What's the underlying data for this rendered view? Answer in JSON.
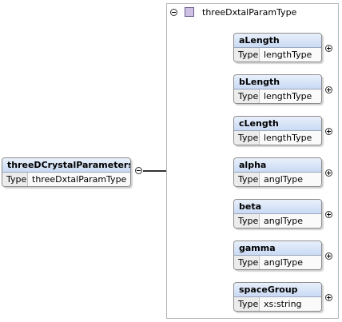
{
  "root": {
    "name": "threeDCrystalParameters",
    "type_key": "Type",
    "type_value": "threeDxtalParamType"
  },
  "complex_type": {
    "name": "threeDxtalParamType"
  },
  "children": [
    {
      "name": "aLength",
      "type_key": "Type",
      "type_value": "lengthType"
    },
    {
      "name": "bLength",
      "type_key": "Type",
      "type_value": "lengthType"
    },
    {
      "name": "cLength",
      "type_key": "Type",
      "type_value": "lengthType"
    },
    {
      "name": "alpha",
      "type_key": "Type",
      "type_value": "anglType"
    },
    {
      "name": "beta",
      "type_key": "Type",
      "type_value": "anglType"
    },
    {
      "name": "gamma",
      "type_key": "Type",
      "type_value": "anglType"
    },
    {
      "name": "spaceGroup",
      "type_key": "Type",
      "type_value": "xs:string"
    }
  ],
  "icons": {
    "collapse": "minus-circle-icon",
    "expand": "plus-circle-icon",
    "sequence": "sequence-compositor-icon",
    "complex_type": "complex-type-icon"
  }
}
